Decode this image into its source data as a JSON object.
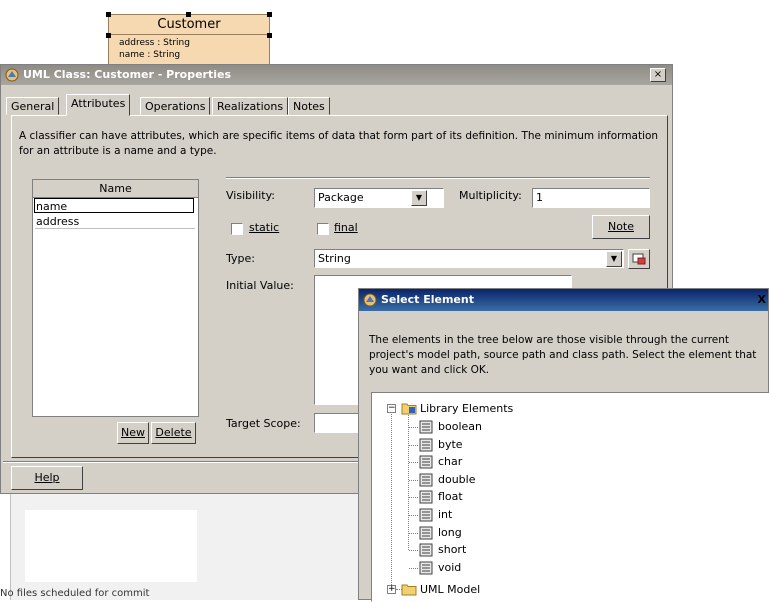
{
  "uml_class": {
    "name": "Customer",
    "attributes": [
      "address : String",
      "name : String"
    ]
  },
  "properties_dialog": {
    "title": "UML Class: Customer - Properties",
    "close_label": "×",
    "tabs": [
      "General",
      "Attributes",
      "Operations",
      "Realizations",
      "Notes"
    ],
    "active_tab": "Attributes",
    "description": "A classifier can have attributes, which are specific items of data that form part of its definition. The minimum information for an attribute is a name and a type.",
    "attributes_list": {
      "header": "Name",
      "rows": [
        "name",
        "address"
      ]
    },
    "new_button": "New",
    "delete_button": "Delete",
    "visibility_label": "Visibility:",
    "visibility_value": "Package",
    "multiplicity_label": "Multiplicity:",
    "multiplicity_value": "1",
    "static_label": "static",
    "final_label": "final",
    "note_button": "Note",
    "type_label": "Type:",
    "type_value": "String",
    "initial_value_label": "Initial Value:",
    "target_scope_label": "Target Scope:",
    "help_button": "Help"
  },
  "status_text": "No files scheduled for commit",
  "select_dialog": {
    "title": "Select Element",
    "close_label": "X",
    "description": "The elements in the tree below are those visible through the current project's model path, source path and class path. Select the element that you want and click OK.",
    "tree": {
      "root": "Library Elements",
      "children": [
        "boolean",
        "byte",
        "char",
        "double",
        "float",
        "int",
        "long",
        "short",
        "void"
      ],
      "sibling": "UML Model"
    }
  },
  "colors": {
    "dialog_bg": "#d4d0c8",
    "uml_box_fill": "#f6d9b0",
    "active_title": "#0a246a",
    "inactive_title": "#8f8c86"
  }
}
